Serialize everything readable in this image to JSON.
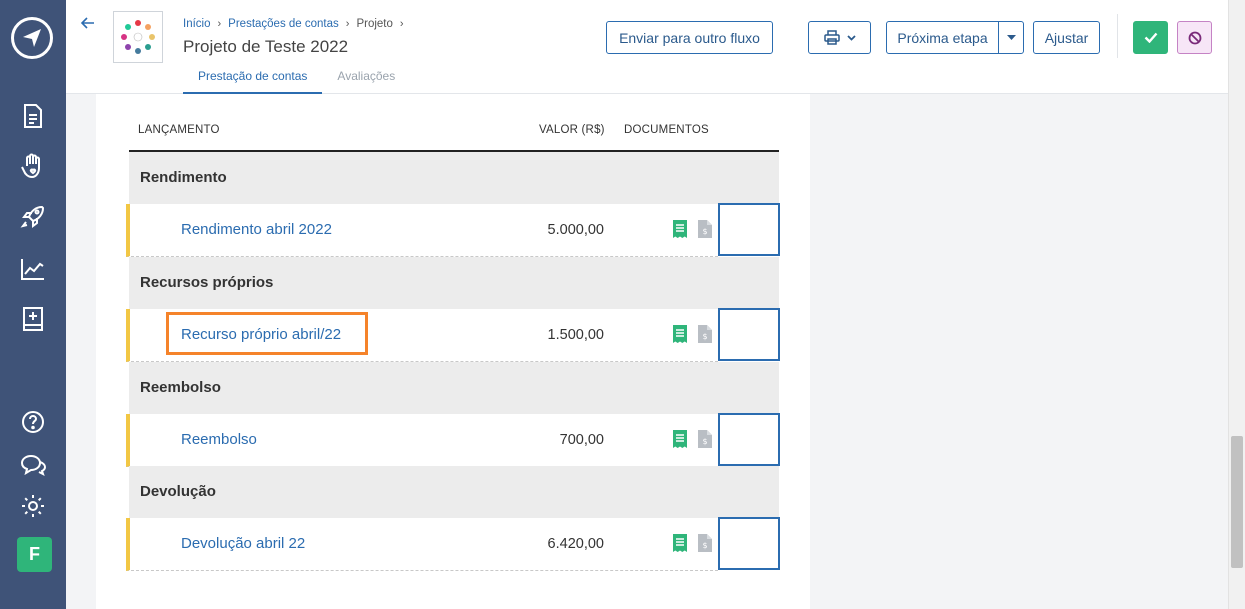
{
  "header": {
    "breadcrumb": [
      "Início",
      "Prestações de contas",
      "Projeto"
    ],
    "title": "Projeto de Teste 2022",
    "tabs": [
      {
        "label": "Prestação de contas",
        "active": true
      },
      {
        "label": "Avaliações",
        "active": false
      }
    ],
    "buttons": {
      "send_flow": "Enviar para outro fluxo",
      "next_step": "Próxima etapa",
      "adjust": "Ajustar"
    }
  },
  "table": {
    "columns": {
      "entry": "LANÇAMENTO",
      "value": "VALOR (R$)",
      "documents": "DOCUMENTOS"
    },
    "groups": [
      {
        "label": "Rendimento",
        "items": [
          {
            "label": "Rendimento abril 2022",
            "value": "5.000,00"
          }
        ]
      },
      {
        "label": "Recursos próprios",
        "items": [
          {
            "label": "Recurso próprio abril/22",
            "value": "1.500,00"
          }
        ]
      },
      {
        "label": "Reembolso",
        "items": [
          {
            "label": "Reembolso",
            "value": "700,00"
          }
        ]
      },
      {
        "label": "Devolução",
        "items": [
          {
            "label": "Devolução abril 22",
            "value": "6.420,00"
          }
        ]
      }
    ]
  },
  "user": {
    "initial": "F"
  },
  "colors": {
    "sidebar": "#3f5378",
    "accent": "#2b6cb0",
    "success": "#2fb57a",
    "highlight": "#f5832a",
    "row_marker": "#f2c744",
    "receipt_icon": "#2fb57a"
  },
  "icons": {
    "sidebar": [
      "paper-plane-icon",
      "document-icon",
      "hand-heart-icon",
      "rocket-icon",
      "chart-line-icon",
      "book-plus-icon",
      "help-icon",
      "chat-icon",
      "gear-icon"
    ],
    "documents": [
      "receipt-icon",
      "invoice-icon"
    ]
  }
}
